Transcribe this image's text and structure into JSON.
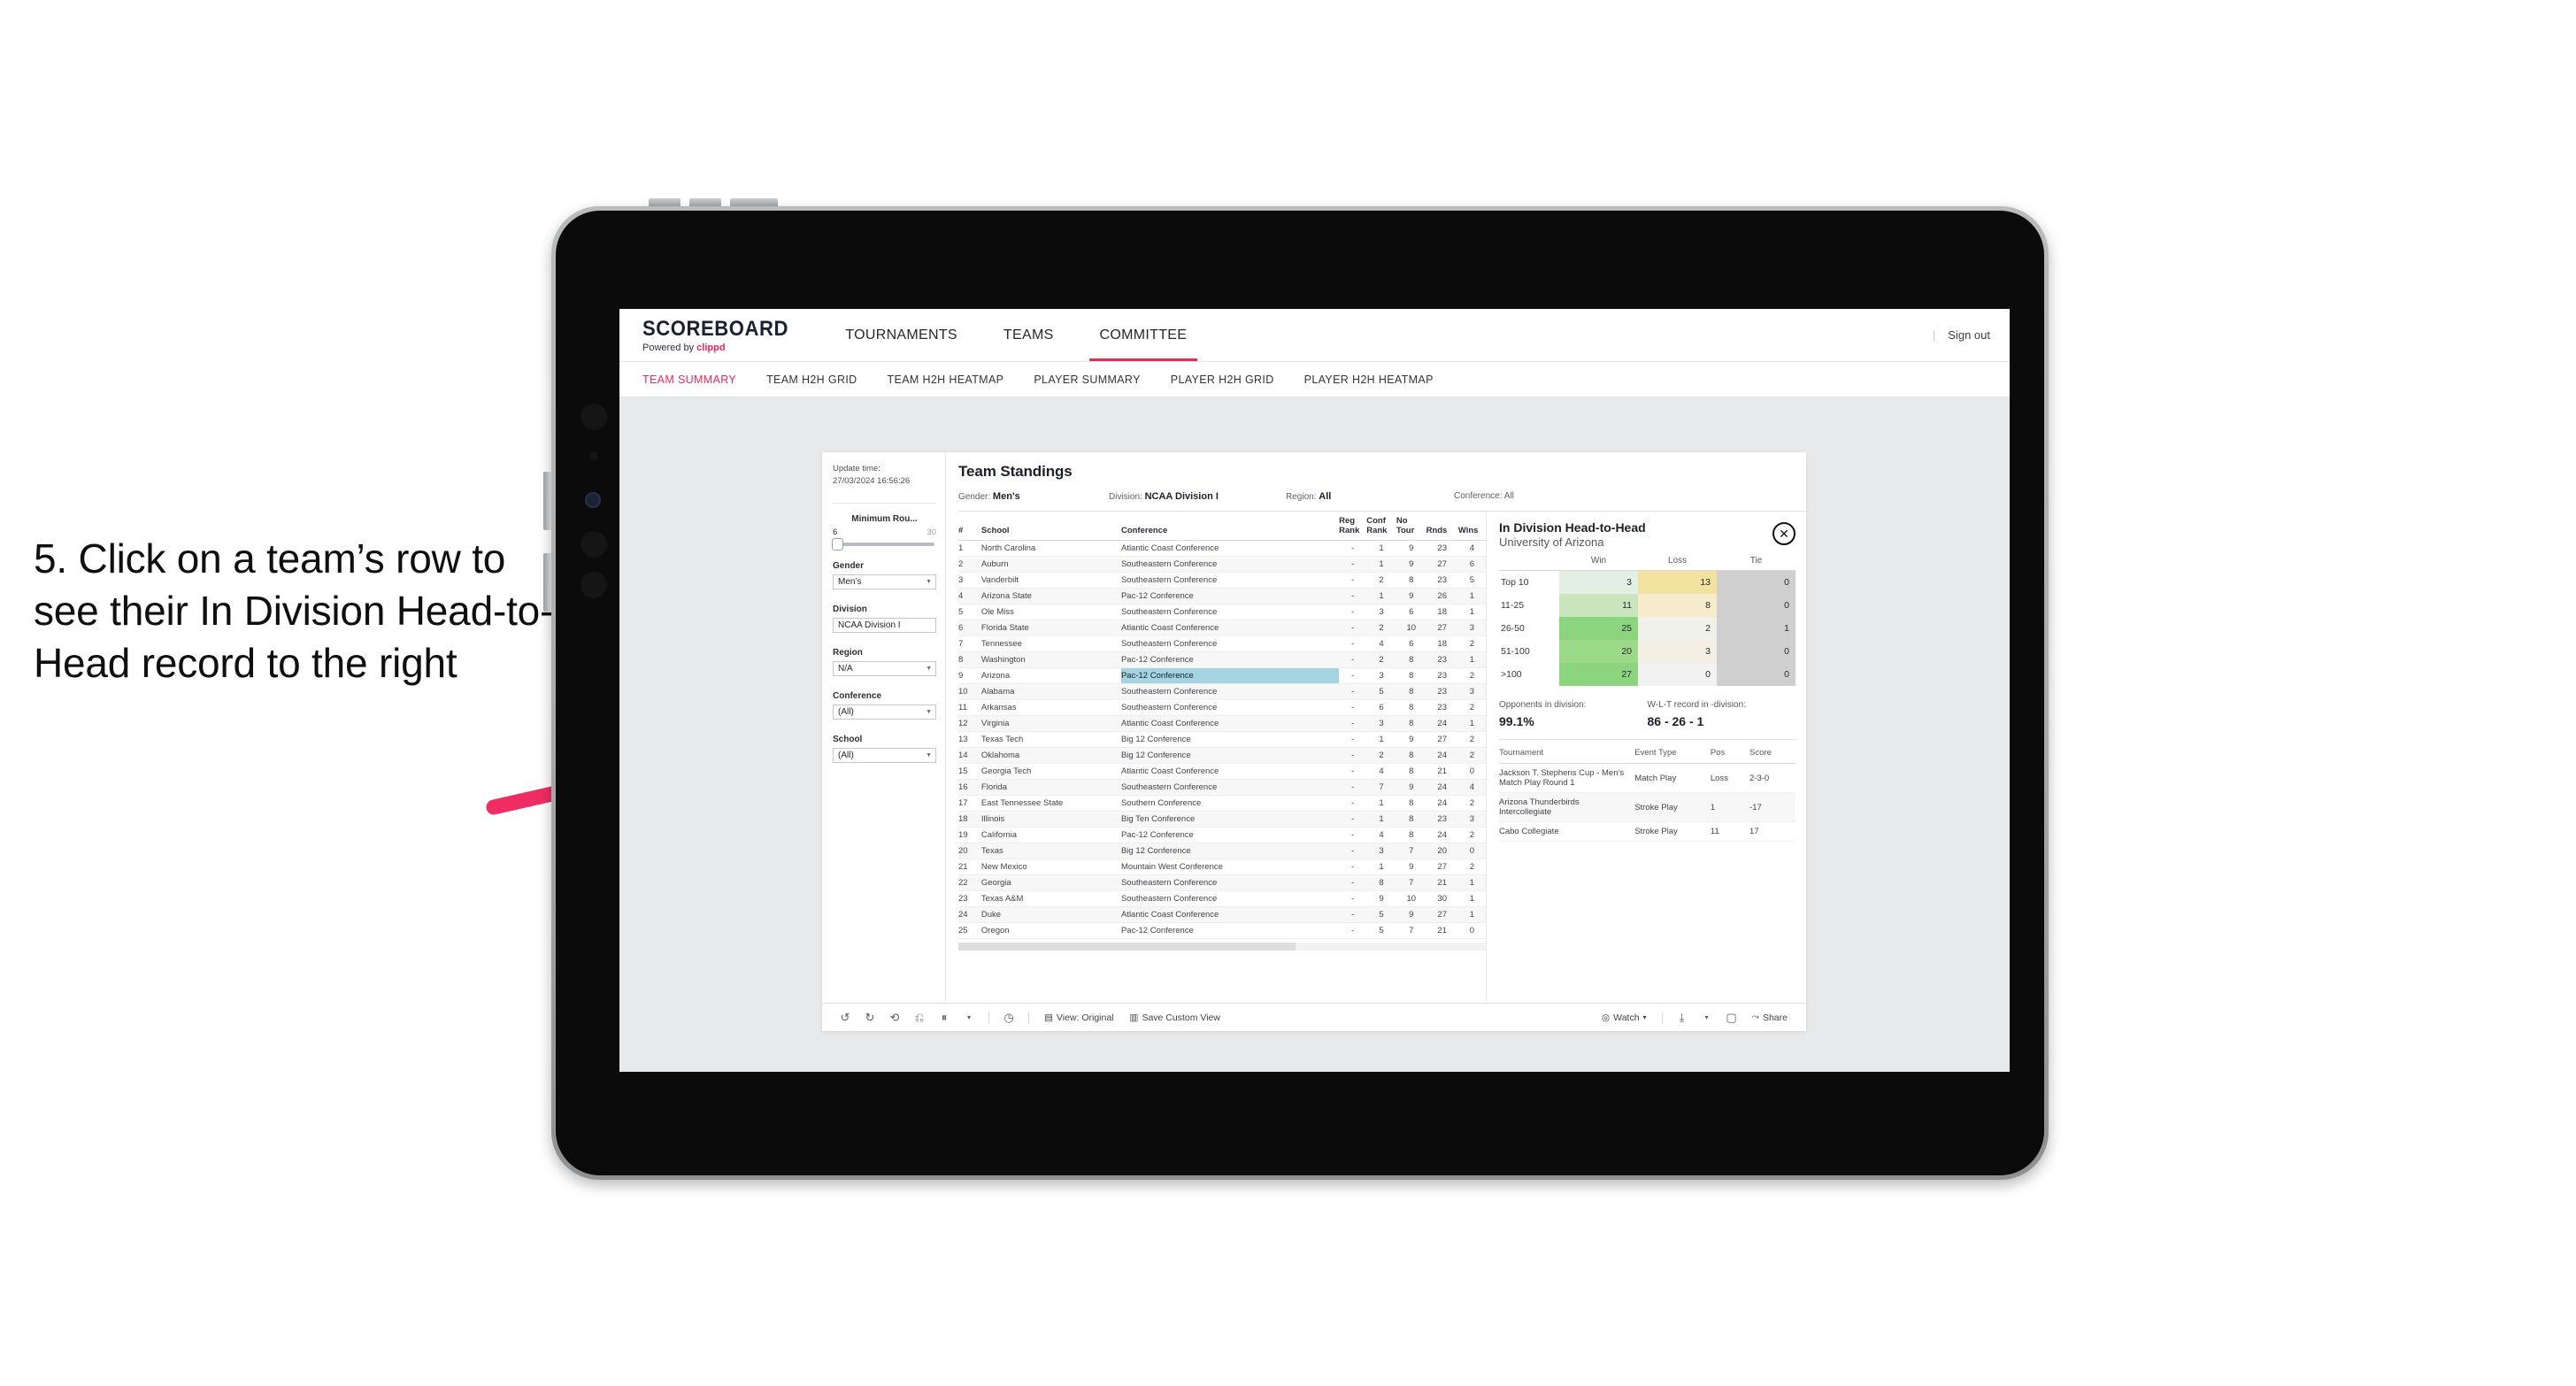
{
  "annotation": {
    "text": "5. Click on a team’s row to see their In Division Head-to-Head record to the right",
    "arrow_color": "#ef2d62"
  },
  "header": {
    "logo_word": "SCOREBOARD",
    "logo_powered": "Powered by ",
    "logo_brand": "clippd",
    "nav": [
      {
        "label": "TOURNAMENTS",
        "active": false
      },
      {
        "label": "TEAMS",
        "active": false
      },
      {
        "label": "COMMITTEE",
        "active": true
      }
    ],
    "divider": "|",
    "sign_out": "Sign out"
  },
  "sub_nav": [
    {
      "label": "TEAM SUMMARY",
      "active": true
    },
    {
      "label": "TEAM H2H GRID",
      "active": false
    },
    {
      "label": "TEAM H2H HEATMAP",
      "active": false
    },
    {
      "label": "PLAYER SUMMARY",
      "active": false
    },
    {
      "label": "PLAYER H2H GRID",
      "active": false
    },
    {
      "label": "PLAYER H2H HEATMAP",
      "active": false
    }
  ],
  "filters": {
    "update_time_label": "Update time:",
    "update_time_value": "27/03/2024 16:56:26",
    "min_rounds": {
      "label": "Minimum Rou...",
      "low": "6",
      "high": "30"
    },
    "gender": {
      "label": "Gender",
      "value": "Men’s"
    },
    "division": {
      "label": "Division",
      "value": "NCAA Division I"
    },
    "region": {
      "label": "Region",
      "value": "N/A"
    },
    "conference": {
      "label": "Conference",
      "value": "(All)"
    },
    "school": {
      "label": "School",
      "value": "(All)"
    }
  },
  "standings": {
    "title": "Team Standings",
    "summary": {
      "gender_label": "Gender:",
      "gender_value": "Men’s",
      "division_label": "Division:",
      "division_value": "NCAA Division I",
      "region_label": "Region:",
      "region_value": "All",
      "conference_label": "Conference:",
      "conference_value": "All"
    },
    "columns": [
      "#",
      "School",
      "Conference",
      "Reg Rank",
      "Conf Rank",
      "No Tour",
      "Rnds",
      "Wins"
    ],
    "col_head": {
      "num": "#",
      "school": "School",
      "conference": "Conference",
      "reg_rank_l1": "Reg",
      "reg_rank_l2": "Rank",
      "conf_rank_l1": "Conf",
      "conf_rank_l2": "Rank",
      "no_tour_l1": "No",
      "no_tour_l2": "Tour",
      "rnds": "Rnds",
      "wins": "Wins"
    },
    "selected_row": 9,
    "rows": [
      {
        "num": "1",
        "school": "North Carolina",
        "conference": "Atlantic Coast Conference",
        "reg_rank": "-",
        "conf_rank": "1",
        "no_tour": "9",
        "rnds": "23",
        "wins": "4"
      },
      {
        "num": "2",
        "school": "Auburn",
        "conference": "Southeastern Conference",
        "reg_rank": "-",
        "conf_rank": "1",
        "no_tour": "9",
        "rnds": "27",
        "wins": "6"
      },
      {
        "num": "3",
        "school": "Vanderbilt",
        "conference": "Southeastern Conference",
        "reg_rank": "-",
        "conf_rank": "2",
        "no_tour": "8",
        "rnds": "23",
        "wins": "5"
      },
      {
        "num": "4",
        "school": "Arizona State",
        "conference": "Pac-12 Conference",
        "reg_rank": "-",
        "conf_rank": "1",
        "no_tour": "9",
        "rnds": "26",
        "wins": "1"
      },
      {
        "num": "5",
        "school": "Ole Miss",
        "conference": "Southeastern Conference",
        "reg_rank": "-",
        "conf_rank": "3",
        "no_tour": "6",
        "rnds": "18",
        "wins": "1"
      },
      {
        "num": "6",
        "school": "Florida State",
        "conference": "Atlantic Coast Conference",
        "reg_rank": "-",
        "conf_rank": "2",
        "no_tour": "10",
        "rnds": "27",
        "wins": "3"
      },
      {
        "num": "7",
        "school": "Tennessee",
        "conference": "Southeastern Conference",
        "reg_rank": "-",
        "conf_rank": "4",
        "no_tour": "6",
        "rnds": "18",
        "wins": "2"
      },
      {
        "num": "8",
        "school": "Washington",
        "conference": "Pac-12 Conference",
        "reg_rank": "-",
        "conf_rank": "2",
        "no_tour": "8",
        "rnds": "23",
        "wins": "1"
      },
      {
        "num": "9",
        "school": "Arizona",
        "conference": "Pac-12 Conference",
        "reg_rank": "-",
        "conf_rank": "3",
        "no_tour": "8",
        "rnds": "23",
        "wins": "2"
      },
      {
        "num": "10",
        "school": "Alabama",
        "conference": "Southeastern Conference",
        "reg_rank": "-",
        "conf_rank": "5",
        "no_tour": "8",
        "rnds": "23",
        "wins": "3"
      },
      {
        "num": "11",
        "school": "Arkansas",
        "conference": "Southeastern Conference",
        "reg_rank": "-",
        "conf_rank": "6",
        "no_tour": "8",
        "rnds": "23",
        "wins": "2"
      },
      {
        "num": "12",
        "school": "Virginia",
        "conference": "Atlantic Coast Conference",
        "reg_rank": "-",
        "conf_rank": "3",
        "no_tour": "8",
        "rnds": "24",
        "wins": "1"
      },
      {
        "num": "13",
        "school": "Texas Tech",
        "conference": "Big 12 Conference",
        "reg_rank": "-",
        "conf_rank": "1",
        "no_tour": "9",
        "rnds": "27",
        "wins": "2"
      },
      {
        "num": "14",
        "school": "Oklahoma",
        "conference": "Big 12 Conference",
        "reg_rank": "-",
        "conf_rank": "2",
        "no_tour": "8",
        "rnds": "24",
        "wins": "2"
      },
      {
        "num": "15",
        "school": "Georgia Tech",
        "conference": "Atlantic Coast Conference",
        "reg_rank": "-",
        "conf_rank": "4",
        "no_tour": "8",
        "rnds": "21",
        "wins": "0"
      },
      {
        "num": "16",
        "school": "Florida",
        "conference": "Southeastern Conference",
        "reg_rank": "-",
        "conf_rank": "7",
        "no_tour": "9",
        "rnds": "24",
        "wins": "4"
      },
      {
        "num": "17",
        "school": "East Tennessee State",
        "conference": "Southern Conference",
        "reg_rank": "-",
        "conf_rank": "1",
        "no_tour": "8",
        "rnds": "24",
        "wins": "2"
      },
      {
        "num": "18",
        "school": "Illinois",
        "conference": "Big Ten Conference",
        "reg_rank": "-",
        "conf_rank": "1",
        "no_tour": "8",
        "rnds": "23",
        "wins": "3"
      },
      {
        "num": "19",
        "school": "California",
        "conference": "Pac-12 Conference",
        "reg_rank": "-",
        "conf_rank": "4",
        "no_tour": "8",
        "rnds": "24",
        "wins": "2"
      },
      {
        "num": "20",
        "school": "Texas",
        "conference": "Big 12 Conference",
        "reg_rank": "-",
        "conf_rank": "3",
        "no_tour": "7",
        "rnds": "20",
        "wins": "0"
      },
      {
        "num": "21",
        "school": "New Mexico",
        "conference": "Mountain West Conference",
        "reg_rank": "-",
        "conf_rank": "1",
        "no_tour": "9",
        "rnds": "27",
        "wins": "2"
      },
      {
        "num": "22",
        "school": "Georgia",
        "conference": "Southeastern Conference",
        "reg_rank": "-",
        "conf_rank": "8",
        "no_tour": "7",
        "rnds": "21",
        "wins": "1"
      },
      {
        "num": "23",
        "school": "Texas A&M",
        "conference": "Southeastern Conference",
        "reg_rank": "-",
        "conf_rank": "9",
        "no_tour": "10",
        "rnds": "30",
        "wins": "1"
      },
      {
        "num": "24",
        "school": "Duke",
        "conference": "Atlantic Coast Conference",
        "reg_rank": "-",
        "conf_rank": "5",
        "no_tour": "9",
        "rnds": "27",
        "wins": "1"
      },
      {
        "num": "25",
        "school": "Oregon",
        "conference": "Pac-12 Conference",
        "reg_rank": "-",
        "conf_rank": "5",
        "no_tour": "7",
        "rnds": "21",
        "wins": "0"
      }
    ]
  },
  "detail": {
    "title": "In Division Head-to-Head",
    "subtitle": "University of Arizona",
    "close_icon": "✕",
    "h2h_columns": [
      "",
      "Win",
      "Loss",
      "Tie"
    ],
    "h2h_col_win": "Win",
    "h2h_col_loss": "Loss",
    "h2h_col_tie": "Tie",
    "h2h_rows": [
      {
        "bucket": "Top 10",
        "win": "3",
        "loss": "13",
        "tie": "0",
        "win_color": "#e3efe2",
        "loss_color": "#f2e2a0",
        "tie_color": "#cfcfcf"
      },
      {
        "bucket": "11-25",
        "win": "11",
        "loss": "8",
        "tie": "0",
        "win_color": "#c9e5bd",
        "loss_color": "#f6eccb",
        "tie_color": "#cfcfcf"
      },
      {
        "bucket": "26-50",
        "win": "25",
        "loss": "2",
        "tie": "1",
        "win_color": "#8cd47e",
        "loss_color": "#f1f1ec",
        "tie_color": "#cfcfcf"
      },
      {
        "bucket": "51-100",
        "win": "20",
        "loss": "3",
        "tie": "0",
        "win_color": "#9cda8a",
        "loss_color": "#f3efe4",
        "tie_color": "#cfcfcf"
      },
      {
        "bucket": ">100",
        "win": "27",
        "loss": "0",
        "tie": "0",
        "win_color": "#8cd47e",
        "loss_color": "#f2f2f2",
        "tie_color": "#cfcfcf"
      }
    ],
    "opponents_label": "Opponents in division:",
    "opponents_value": "99.1%",
    "record_label": "W-L-T record in -division:",
    "record_value": "86 - 26 - 1",
    "tour_columns": [
      "Tournament",
      "Event Type",
      "Pos",
      "Score"
    ],
    "tour_col_tournament": "Tournament",
    "tour_col_event": "Event Type",
    "tour_col_pos": "Pos",
    "tour_col_score": "Score",
    "tour_rows": [
      {
        "tournament": "Jackson T. Stephens Cup - Men’s Match Play Round 1",
        "event": "Match Play",
        "pos": "Loss",
        "score": "2-3-0"
      },
      {
        "tournament": "Arizona Thunderbirds Intercollegiate",
        "event": "Stroke Play",
        "pos": "1",
        "score": "-17"
      },
      {
        "tournament": "Cabo Collegiate",
        "event": "Stroke Play",
        "pos": "11",
        "score": "17"
      }
    ]
  },
  "toolbar": {
    "undo": "undo-icon",
    "redo": "redo-icon",
    "revert": "revert-icon",
    "refresh": "refresh-icon",
    "pause": "pause-icon",
    "view_label": "View: Original",
    "save_label": "Save Custom View",
    "watch_label": "Watch",
    "share_label": "Share"
  }
}
